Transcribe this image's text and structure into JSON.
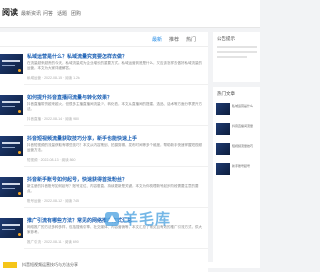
{
  "header": {
    "brand": "阅读",
    "nav": [
      "最新资讯",
      "问答",
      "话题",
      "团购"
    ]
  },
  "main": {
    "tabs": [
      "最新",
      "推荐",
      "热门"
    ],
    "articles": [
      {
        "title": "私域运营是什么？私域流量究竟要怎样去做？",
        "desc": "在流量越来越贵的今天，私域流量成为企业增长的重要方式。私域运营到底是什么，又应该怎样去做好私域流量的运营，本文为大家详细解答。",
        "meta": "私域运营 · 2022-08-15 · 阅读 1.2k"
      },
      {
        "title": "如何提升抖音直播间流量与转化效果？",
        "desc": "抖音直播带货越来越火，但很多主播直播间流量少、转化低，本文从直播间的搭建、选品、话术等方面分享提升方法。",
        "meta": "抖音直播 · 2022-08-14 · 阅读 980"
      },
      {
        "title": "抖音短视频流量获取技巧分享，新手也能快速上手",
        "desc": "抖音短视频的流量获取有哪些技巧？本文从内容策划、拍摄剪辑、发布时间等多个维度，帮助新手快速掌握短视频运营方法。",
        "meta": "短视频 · 2022-08-13 · 阅读 860"
      },
      {
        "title": "抖音新手账号如何起号，快速获得首批粉丝？",
        "desc": "新注册的抖音账号如何起号？账号定位、内容垂直、持续更新是关键，本文为你梳理新号起步阶段需要注意的要点。",
        "meta": "账号运营 · 2022-08-12 · 阅读 745"
      },
      {
        "title": "推广引流有哪些方法？常见的网络推广方式汇总",
        "desc": "网络推广的方法多种多样，包括搜索引擎、社交媒体、内容营销等，本文汇总了常见且有效的推广引流方式，供大家参考。",
        "meta": "推广引流 · 2022-08-11 · 阅读 690"
      }
    ]
  },
  "sidebar": {
    "notice_title": "公告提示",
    "hot_title": "热门文章",
    "hot_items": [
      "私域运营是什么",
      "抖音直播间流量",
      "短视频流量技巧",
      "新手账号起号"
    ]
  },
  "watermark": {
    "text": "羊毛库"
  },
  "footer": {
    "teaser": "抖音短视频运营技巧与方法分享"
  },
  "colors": {
    "accent": "#1e88e5",
    "watermark": "#4fa3e0",
    "badge": "#f5c518"
  }
}
